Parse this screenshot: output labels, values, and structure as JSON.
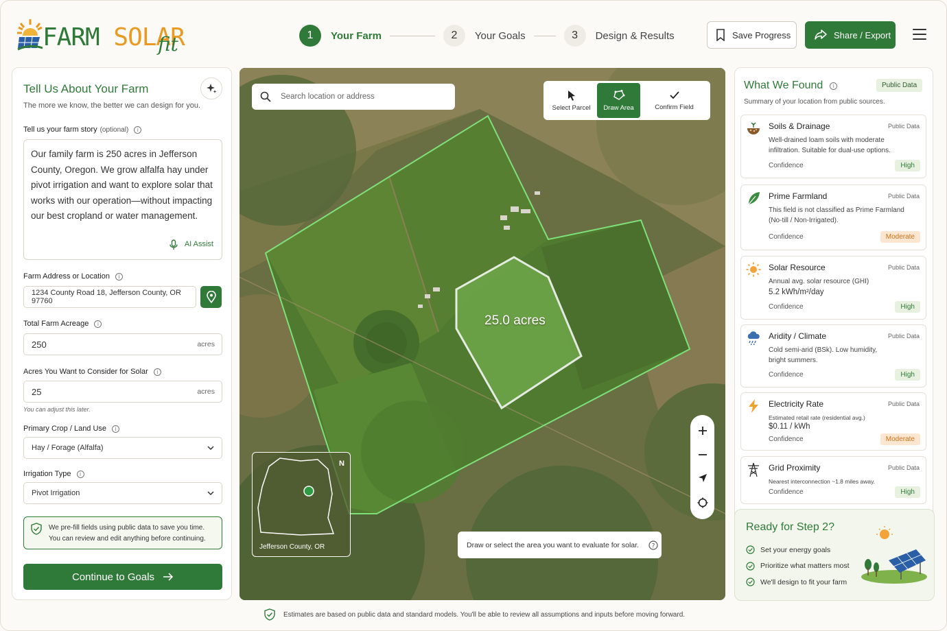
{
  "brand": {
    "farm": "FARM",
    "solar": "SOLAR",
    "fit": "fit"
  },
  "stepper": [
    {
      "num": "1",
      "label": "Your Farm",
      "state": "active"
    },
    {
      "num": "2",
      "label": "Your Goals",
      "state": "inactive"
    },
    {
      "num": "3",
      "label": "Design & Results",
      "state": "inactive"
    }
  ],
  "header": {
    "save_label": "Save Progress",
    "share_label": "Share / Export"
  },
  "form": {
    "title": "Tell Us About Your Farm",
    "subtitle": "The more we know, the better we can design for you.",
    "story_label": "Tell us your farm story",
    "story_optional": "(optional)",
    "story_text": "Our family farm is 250 acres in Jefferson County, Oregon. We grow alfalfa hay under pivot irrigation and want to explore solar that works with our operation—without impacting our best cropland or water management.",
    "ai_assist": "AI Assist",
    "address_label": "Farm Address or Location",
    "address_value": "1234 County Road 18, Jefferson County, OR 97760",
    "acreage_label": "Total Farm Acreage",
    "acreage_value": "250",
    "acreage_unit": "acres",
    "solar_label": "Acres You Want to Consider for Solar",
    "solar_value": "25",
    "solar_unit": "acres",
    "solar_helper": "You can adjust this later.",
    "crop_label": "Primary Crop / Land Use",
    "crop_value": "Hay / Forage (Alfalfa)",
    "irrigation_label": "Irrigation Type",
    "irrigation_value": "Pivot Irrigation",
    "prefill_line1": "We pre-fill fields using public data to save you time.",
    "prefill_line2": "You can review and edit anything before continuing.",
    "continue_label": "Continue to Goals"
  },
  "map": {
    "search_placeholder": "Search location or address",
    "tools": [
      {
        "label": "Select Parcel",
        "state": "inactive"
      },
      {
        "label": "Draw Area",
        "state": "active"
      },
      {
        "label": "Confirm Field",
        "state": "inactive"
      }
    ],
    "selected_area": "25.0 acres",
    "inset_label": "Jefferson County, OR",
    "inset_north": "N",
    "hint": "Draw or select the area you want to evaluate for solar."
  },
  "findings": {
    "title": "What We Found",
    "badge": "Public Data",
    "subtitle": "Summary of your location from public sources.",
    "conf_label": "Confidence",
    "cards": [
      {
        "icon": "soil-icon",
        "title": "Soils & Drainage",
        "source": "Public Data",
        "desc": "Well-drained loam soils with moderate infiltration. Suitable for dual-use options.",
        "value": "",
        "confidence": "High"
      },
      {
        "icon": "leaf-icon",
        "title": "Prime Farmland",
        "source": "Public Data",
        "desc": "This field is not classified as Prime Farmland (No-till / Non-Irrigated).",
        "value": "",
        "confidence": "Moderate"
      },
      {
        "icon": "sun-icon",
        "title": "Solar Resource",
        "source": "Public Data",
        "desc": "Annual avg. solar resource (GHI)",
        "value": "5.2 kWh/m²/day",
        "confidence": "High"
      },
      {
        "icon": "rain-cloud-icon",
        "title": "Aridity / Climate",
        "source": "Public Data",
        "desc": "Cold semi-arid (BSk). Low humidity, bright summers.",
        "value": "",
        "confidence": "High"
      },
      {
        "icon": "lightning-icon",
        "title": "Electricity Rate",
        "source": "Public Data",
        "desc": "Estimated retail rate (residential avg.)",
        "value": "$0.11 / kWh",
        "confidence": "Moderate"
      },
      {
        "icon": "power-tower-icon",
        "title": "Grid Proximity",
        "source": "Public Data",
        "desc": "Nearest interconnection ~1.8 miles away.",
        "value": "",
        "confidence": "High"
      }
    ]
  },
  "ready": {
    "title": "Ready for Step 2?",
    "items": [
      "Set your energy goals",
      "Prioritize what matters most",
      "We'll design to fit your farm"
    ]
  },
  "footer": {
    "note": "Estimates are based on public data and standard models. You'll be able to review all assumptions and inputs before moving forward."
  }
}
